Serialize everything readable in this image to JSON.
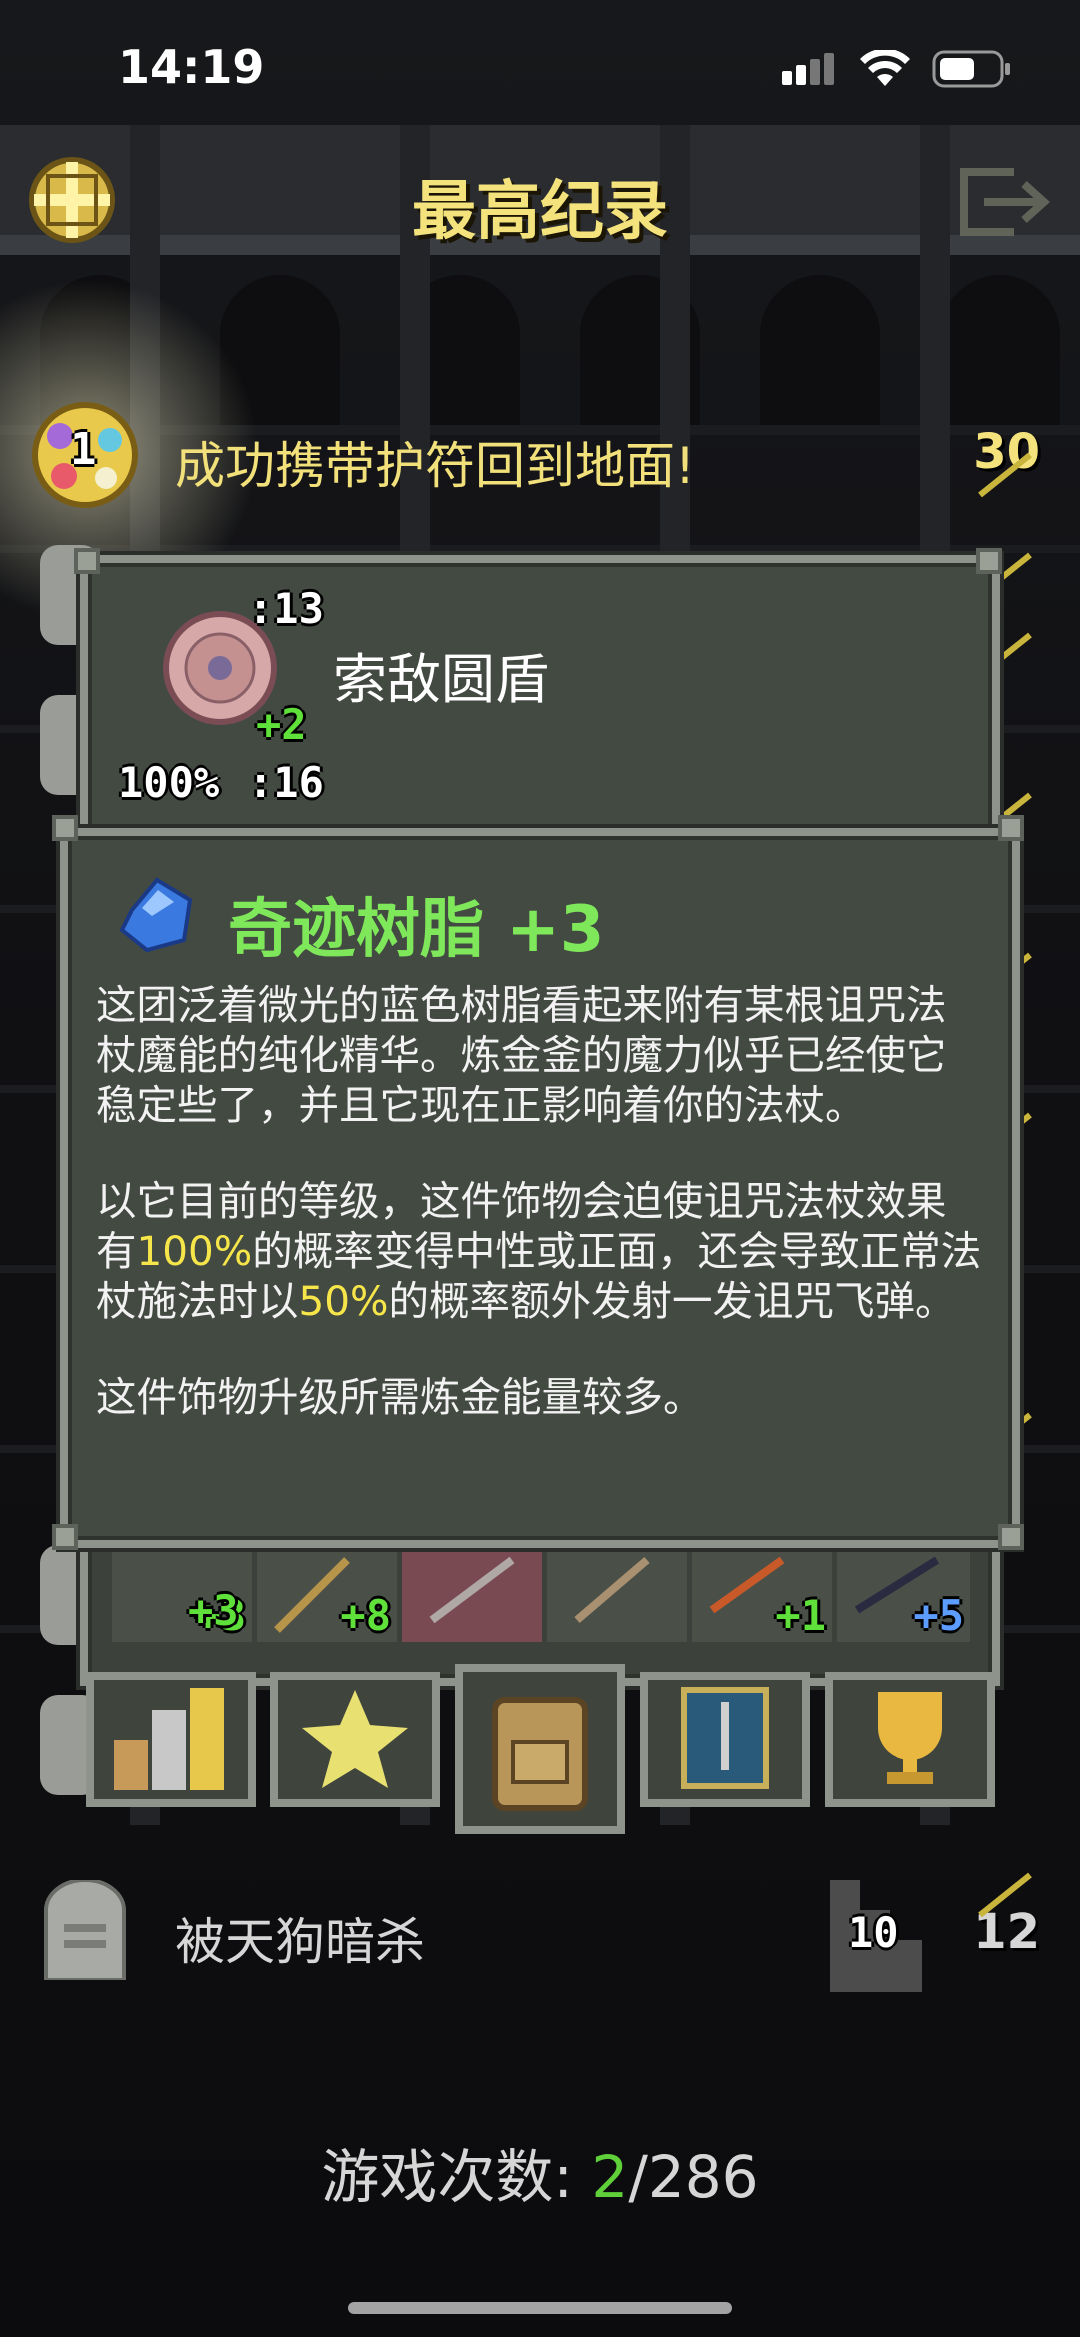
{
  "status_bar": {
    "time": "14:19"
  },
  "header": {
    "title": "最高纪录"
  },
  "records": [
    {
      "rank": "1",
      "text": "成功携带护符回到地面!",
      "score": "30"
    },
    {
      "text": "被天狗暗杀",
      "depth": "10",
      "score": "12"
    }
  ],
  "item_panel": {
    "name": "索敌圆盾",
    "upgrade": "+2",
    "str_top": ":13",
    "accuracy": "100%",
    "str_bottom": ":16"
  },
  "info_panel": {
    "title": "奇迹树脂 +3",
    "paragraphs": [
      [
        "这团泛着微光的蓝色树脂看起来附有某根诅咒法杖魔能的纯化精华。炼金釜的魔力似乎已经使它稳定些了，并且它现在正影响着你的法杖。"
      ],
      [
        "以它目前的等级，这件饰物会迫使诅咒法杖效果有",
        "100%",
        "的概率变得中性或正面，还会导致正常法杖施法时以",
        "50%",
        "的概率额外发射一发诅咒飞弹。"
      ],
      [
        "这件饰物升级所需炼金能量较多。"
      ]
    ]
  },
  "inventory_row": {
    "levels": [
      "+3",
      "+8",
      "",
      "",
      "+1",
      "+5"
    ]
  },
  "tabs": [
    "stats-tab",
    "badges-tab",
    "inventory-tab",
    "challenges-tab",
    "rankings-tab"
  ],
  "footer": {
    "label": "游戏次数: ",
    "current": "2",
    "separator": "/",
    "total": "286"
  },
  "colors": {
    "gold_text": "#f4e27c",
    "green_title": "#7fe85a",
    "highlight": "#f6e64a",
    "panel_bg": "#434a42",
    "panel_border": "#8e948b"
  }
}
